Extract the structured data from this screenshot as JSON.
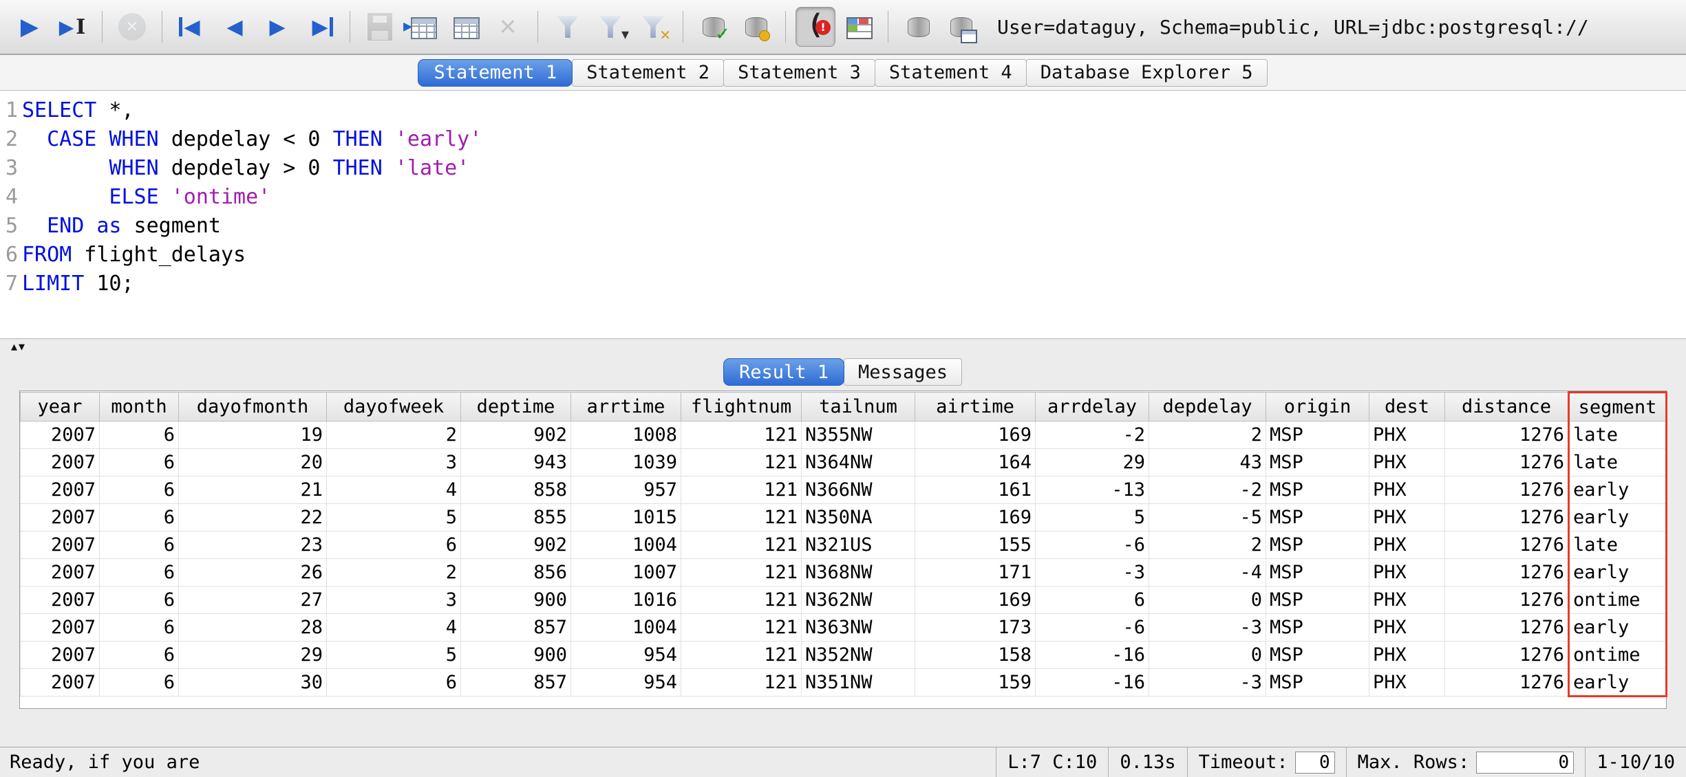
{
  "colors": {
    "active_tab": "#2f6cd4",
    "keyword": "#0010e0",
    "string": "#a21caf",
    "highlight_box": "#e8392a"
  },
  "toolbar": {
    "connection_info": "User=dataguy, Schema=public, URL=jdbc:postgresql://",
    "groups": [
      {
        "buttons": [
          {
            "name": "execute-statement",
            "kind": "play"
          },
          {
            "name": "execute-current",
            "kind": "play-cursor"
          }
        ]
      },
      {
        "buttons": [
          {
            "name": "cancel-statement",
            "kind": "stop",
            "disabled": true
          }
        ]
      },
      {
        "buttons": [
          {
            "name": "first-row",
            "kind": "nav-first"
          },
          {
            "name": "previous-row",
            "kind": "nav-prev"
          },
          {
            "name": "next-row",
            "kind": "nav-next"
          },
          {
            "name": "last-row",
            "kind": "nav-last"
          }
        ]
      },
      {
        "buttons": [
          {
            "name": "save-changes",
            "kind": "floppy",
            "disabled": true
          },
          {
            "name": "update-database",
            "kind": "update"
          },
          {
            "name": "insert-row",
            "kind": "insert"
          },
          {
            "name": "delete-row",
            "kind": "delete",
            "disabled": true
          }
        ]
      },
      {
        "buttons": [
          {
            "name": "filter-data",
            "kind": "filter"
          },
          {
            "name": "filter-dropdown",
            "kind": "filter-drop"
          },
          {
            "name": "reset-filter",
            "kind": "filter-reset"
          }
        ]
      },
      {
        "buttons": [
          {
            "name": "commit",
            "kind": "db-check"
          },
          {
            "name": "rollback",
            "kind": "db-edit"
          }
        ]
      },
      {
        "buttons": [
          {
            "name": "connection-status",
            "kind": "conn",
            "pressed": true
          },
          {
            "name": "data-pumper",
            "kind": "table-color"
          }
        ]
      },
      {
        "buttons": [
          {
            "name": "database",
            "kind": "db"
          },
          {
            "name": "database-explorer",
            "kind": "db-table"
          }
        ]
      }
    ]
  },
  "statement_tabs": [
    {
      "label": "Statement 1",
      "active": true
    },
    {
      "label": "Statement 2",
      "active": false
    },
    {
      "label": "Statement 3",
      "active": false
    },
    {
      "label": "Statement 4",
      "active": false
    },
    {
      "label": "Database Explorer 5",
      "active": false
    }
  ],
  "editor": {
    "lines": [
      {
        "n": "1",
        "parts": [
          [
            "k",
            "SELECT"
          ],
          [
            "p",
            " *,"
          ]
        ]
      },
      {
        "n": "2",
        "parts": [
          [
            "p",
            "  "
          ],
          [
            "k",
            "CASE"
          ],
          [
            "p",
            " "
          ],
          [
            "k",
            "WHEN"
          ],
          [
            "p",
            " depdelay < 0 "
          ],
          [
            "k",
            "THEN"
          ],
          [
            "p",
            " "
          ],
          [
            "s",
            "'early'"
          ]
        ]
      },
      {
        "n": "3",
        "parts": [
          [
            "p",
            "       "
          ],
          [
            "k",
            "WHEN"
          ],
          [
            "p",
            " depdelay > 0 "
          ],
          [
            "k",
            "THEN"
          ],
          [
            "p",
            " "
          ],
          [
            "s",
            "'late'"
          ]
        ]
      },
      {
        "n": "4",
        "parts": [
          [
            "p",
            "       "
          ],
          [
            "k",
            "ELSE"
          ],
          [
            "p",
            " "
          ],
          [
            "s",
            "'ontime'"
          ]
        ]
      },
      {
        "n": "5",
        "parts": [
          [
            "p",
            "  "
          ],
          [
            "k",
            "END"
          ],
          [
            "p",
            " "
          ],
          [
            "k",
            "as"
          ],
          [
            "p",
            " segment"
          ]
        ]
      },
      {
        "n": "6",
        "parts": [
          [
            "k",
            "FROM"
          ],
          [
            "p",
            " flight_delays"
          ]
        ]
      },
      {
        "n": "7",
        "parts": [
          [
            "k",
            "LIMIT"
          ],
          [
            "p",
            " 10;"
          ]
        ]
      }
    ]
  },
  "result_tabs": [
    {
      "label": "Result 1",
      "active": true
    },
    {
      "label": "Messages",
      "active": false
    }
  ],
  "table": {
    "highlight_column": "segment",
    "columns": [
      {
        "label": "year",
        "align": "right"
      },
      {
        "label": "month",
        "align": "right"
      },
      {
        "label": "dayofmonth",
        "align": "right"
      },
      {
        "label": "dayofweek",
        "align": "right"
      },
      {
        "label": "deptime",
        "align": "right"
      },
      {
        "label": "arrtime",
        "align": "right"
      },
      {
        "label": "flightnum",
        "align": "right"
      },
      {
        "label": "tailnum",
        "align": "left"
      },
      {
        "label": "airtime",
        "align": "right"
      },
      {
        "label": "arrdelay",
        "align": "right"
      },
      {
        "label": "depdelay",
        "align": "right"
      },
      {
        "label": "origin",
        "align": "left"
      },
      {
        "label": "dest",
        "align": "left"
      },
      {
        "label": "distance",
        "align": "right"
      },
      {
        "label": "segment",
        "align": "left"
      }
    ],
    "rows": [
      [
        "2007",
        "6",
        "19",
        "2",
        "902",
        "1008",
        "121",
        "N355NW",
        "169",
        "-2",
        "2",
        "MSP",
        "PHX",
        "1276",
        "late"
      ],
      [
        "2007",
        "6",
        "20",
        "3",
        "943",
        "1039",
        "121",
        "N364NW",
        "164",
        "29",
        "43",
        "MSP",
        "PHX",
        "1276",
        "late"
      ],
      [
        "2007",
        "6",
        "21",
        "4",
        "858",
        "957",
        "121",
        "N366NW",
        "161",
        "-13",
        "-2",
        "MSP",
        "PHX",
        "1276",
        "early"
      ],
      [
        "2007",
        "6",
        "22",
        "5",
        "855",
        "1015",
        "121",
        "N350NA",
        "169",
        "5",
        "-5",
        "MSP",
        "PHX",
        "1276",
        "early"
      ],
      [
        "2007",
        "6",
        "23",
        "6",
        "902",
        "1004",
        "121",
        "N321US",
        "155",
        "-6",
        "2",
        "MSP",
        "PHX",
        "1276",
        "late"
      ],
      [
        "2007",
        "6",
        "26",
        "2",
        "856",
        "1007",
        "121",
        "N368NW",
        "171",
        "-3",
        "-4",
        "MSP",
        "PHX",
        "1276",
        "early"
      ],
      [
        "2007",
        "6",
        "27",
        "3",
        "900",
        "1016",
        "121",
        "N362NW",
        "169",
        "6",
        "0",
        "MSP",
        "PHX",
        "1276",
        "ontime"
      ],
      [
        "2007",
        "6",
        "28",
        "4",
        "857",
        "1004",
        "121",
        "N363NW",
        "173",
        "-6",
        "-3",
        "MSP",
        "PHX",
        "1276",
        "early"
      ],
      [
        "2007",
        "6",
        "29",
        "5",
        "900",
        "954",
        "121",
        "N352NW",
        "158",
        "-16",
        "0",
        "MSP",
        "PHX",
        "1276",
        "ontime"
      ],
      [
        "2007",
        "6",
        "30",
        "6",
        "857",
        "954",
        "121",
        "N351NW",
        "159",
        "-16",
        "-3",
        "MSP",
        "PHX",
        "1276",
        "early"
      ]
    ]
  },
  "status_bar": {
    "message": "Ready, if you are",
    "cursor_position": "L:7 C:10",
    "execution_time": "0.13s",
    "timeout_label": "Timeout:",
    "timeout_value": "0",
    "max_rows_label": "Max. Rows:",
    "max_rows_value": "0",
    "row_range": "1-10/10"
  }
}
